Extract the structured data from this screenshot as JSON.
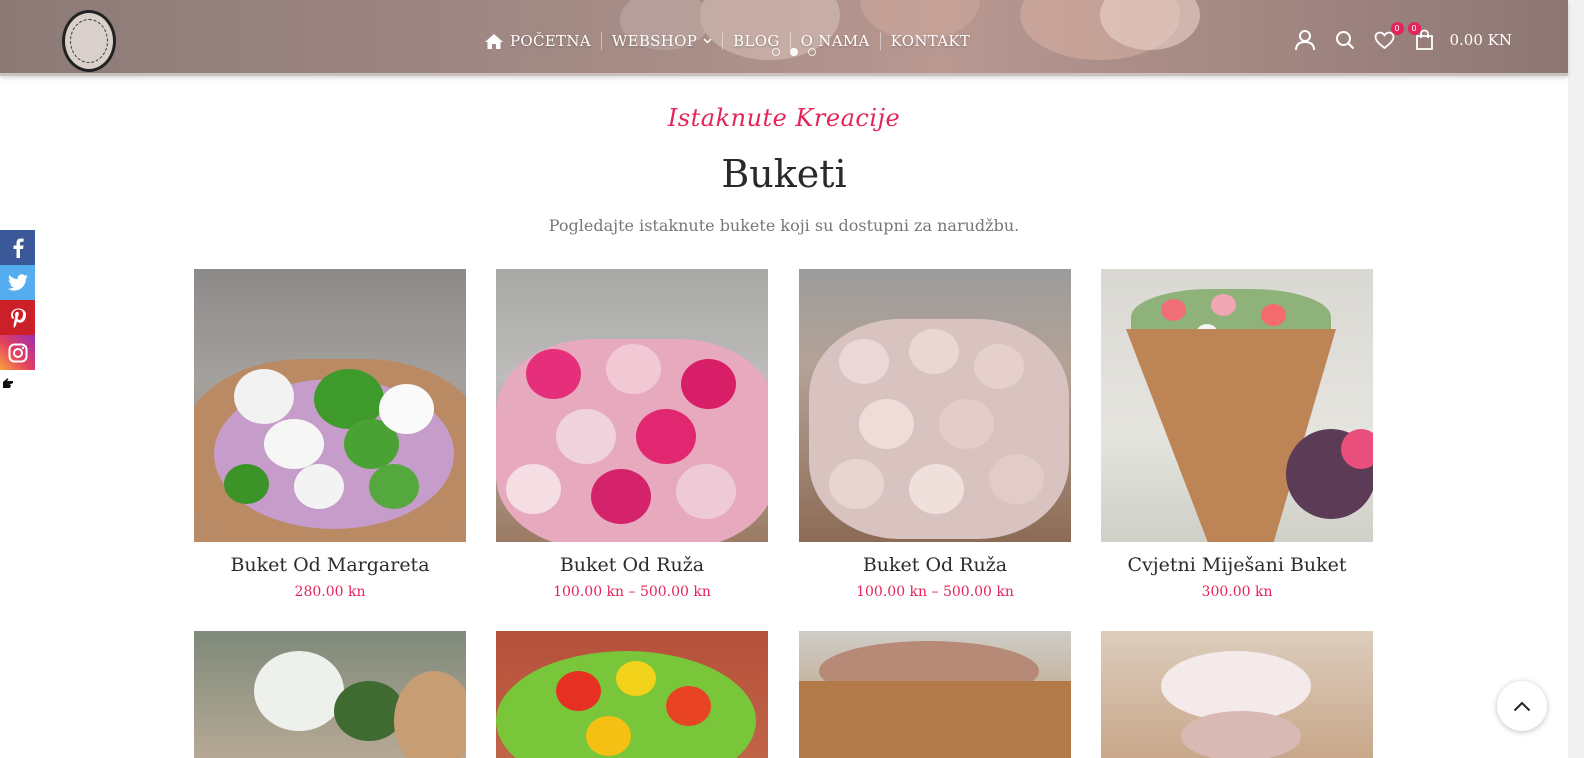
{
  "header": {
    "nav": [
      {
        "label": "POČETNA",
        "icon": "home-icon"
      },
      {
        "label": "WEBSHOP",
        "icon": "chevron-down-icon"
      },
      {
        "label": "BLOG"
      },
      {
        "label": "O NAMA"
      },
      {
        "label": "KONTAKT"
      }
    ],
    "wishlist_count": "0",
    "cart_count": "0",
    "cart_total": "0.00 KN"
  },
  "social": [
    "facebook-icon",
    "twitter-icon",
    "pinterest-icon",
    "instagram-icon"
  ],
  "section": {
    "script_title": "Istaknute Kreacije",
    "title": "Buketi",
    "subtitle": "Pogledajte istaknute bukete koji su dostupni za narudžbu."
  },
  "products": [
    {
      "name": "Buket Od Margareta",
      "price": "280.00 kn"
    },
    {
      "name": "Buket Od Ruža",
      "price": "100.00 kn – 500.00 kn"
    },
    {
      "name": "Buket Od Ruža",
      "price": "100.00 kn – 500.00 kn"
    },
    {
      "name": "Cvjetni Miješani Buket",
      "price": "300.00 kn"
    }
  ],
  "colors": {
    "accent": "#e4245a",
    "header_bg": "#9e8884"
  }
}
